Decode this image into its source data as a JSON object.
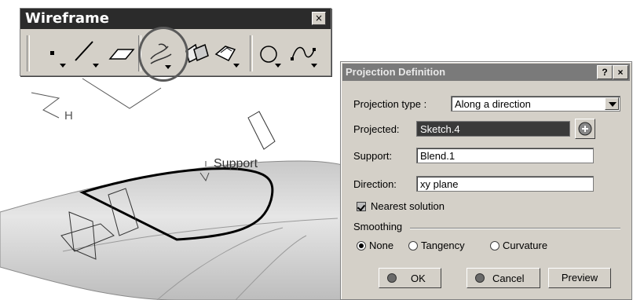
{
  "toolbar": {
    "title": "Wireframe",
    "close_glyph": "×",
    "buttons": [
      {
        "icon": "point-icon"
      },
      {
        "icon": "line-icon"
      },
      {
        "icon": "plane-icon"
      },
      {
        "icon": "projection-icon"
      },
      {
        "icon": "intersection-icon"
      },
      {
        "icon": "offset-icon"
      },
      {
        "icon": "circle-icon"
      },
      {
        "icon": "spline-icon"
      }
    ]
  },
  "viewport": {
    "label_h": "H",
    "label_support": "Support"
  },
  "dialog": {
    "title": "Projection Definition",
    "help_glyph": "?",
    "close_glyph": "×",
    "projection_type_label": "Projection type :",
    "projection_type_value": "Along a direction",
    "projected_label": "Projected:",
    "projected_value": "Sketch.4",
    "support_label": "Support:",
    "support_value": "Blend.1",
    "direction_label": "Direction:",
    "direction_value": "xy plane",
    "nearest_solution_label": "Nearest solution",
    "nearest_solution_checked": true,
    "smoothing_label": "Smoothing",
    "smoothing_options": [
      "None",
      "Tangency",
      "Curvature"
    ],
    "smoothing_selected": "None",
    "ok_label": "OK",
    "cancel_label": "Cancel",
    "preview_label": "Preview"
  }
}
